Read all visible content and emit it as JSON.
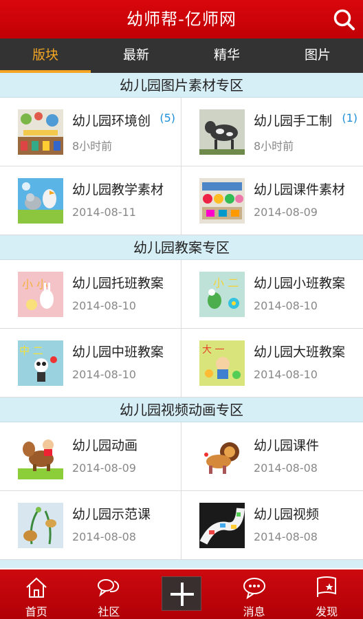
{
  "app": {
    "title": "幼师帮-亿师网"
  },
  "tabs": [
    {
      "label": "版块",
      "active": true
    },
    {
      "label": "最新",
      "active": false
    },
    {
      "label": "精华",
      "active": false
    },
    {
      "label": "图片",
      "active": false
    }
  ],
  "sections": [
    {
      "title": "幼儿园图片素材专区",
      "items": [
        {
          "title": "幼儿园环境创",
          "count": "(5)",
          "date": "8小时前",
          "thumb": "classroom-decoration-thumbnail"
        },
        {
          "title": "幼儿园手工制",
          "count": "(1)",
          "date": "8小时前",
          "thumb": "cow-craft-thumbnail"
        },
        {
          "title": "幼儿园教学素材",
          "count": "",
          "date": "2014-08-11",
          "thumb": "cartoon-animals-thumbnail"
        },
        {
          "title": "幼儿园课件素材",
          "count": "",
          "date": "2014-08-09",
          "thumb": "wall-display-thumbnail"
        }
      ]
    },
    {
      "title": "幼儿园教案专区",
      "items": [
        {
          "title": "幼儿园托班教案",
          "count": "",
          "date": "2014-08-10",
          "thumb": "nursery-class-thumbnail"
        },
        {
          "title": "幼儿园小班教案",
          "count": "",
          "date": "2014-08-10",
          "thumb": "small-class-thumbnail"
        },
        {
          "title": "幼儿园中班教案",
          "count": "",
          "date": "2014-08-10",
          "thumb": "middle-class-thumbnail"
        },
        {
          "title": "幼儿园大班教案",
          "count": "",
          "date": "2014-08-10",
          "thumb": "big-class-thumbnail"
        }
      ]
    },
    {
      "title": "幼儿园视频动画专区",
      "items": [
        {
          "title": "幼儿园动画",
          "count": "",
          "date": "2014-08-09",
          "thumb": "cartoon-horse-thumbnail"
        },
        {
          "title": "幼儿园课件",
          "count": "",
          "date": "2014-08-08",
          "thumb": "lion-thumbnail"
        },
        {
          "title": "幼儿园示范课",
          "count": "",
          "date": "2014-08-08",
          "thumb": "plant-craft-thumbnail"
        },
        {
          "title": "幼儿园视频",
          "count": "",
          "date": "2014-08-08",
          "thumb": "film-strip-thumbnail"
        }
      ]
    }
  ],
  "bottom_nav": [
    {
      "label": "首页",
      "icon": "home-icon"
    },
    {
      "label": "社区",
      "icon": "chat-bubbles-icon"
    },
    {
      "label": "",
      "icon": "plus-icon"
    },
    {
      "label": "消息",
      "icon": "message-icon"
    },
    {
      "label": "发现",
      "icon": "flag-icon"
    }
  ],
  "colors": {
    "header": "#c90308",
    "tabs_bg": "#333333",
    "active_tab": "#f4a623",
    "section_bg": "#d6eef6",
    "count": "#1d8fd8"
  }
}
